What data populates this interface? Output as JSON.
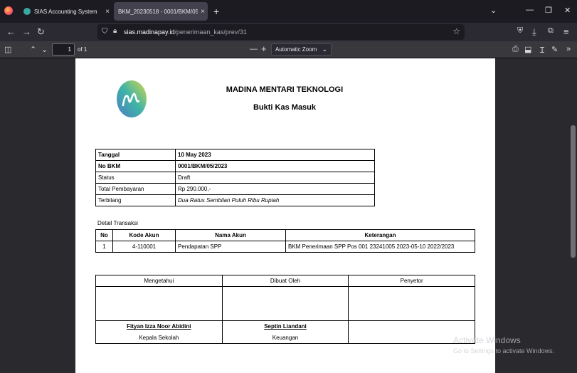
{
  "tabs": [
    {
      "label": "SIAS Accounting System",
      "close": "×"
    },
    {
      "label": "BKM_20230518 - 0001/BKM/05/2023",
      "close": "×"
    }
  ],
  "new_tab": "+",
  "window_controls": {
    "list": "⌄",
    "minimize": "—",
    "restore": "❐",
    "close": "✕"
  },
  "nav": {
    "back": "←",
    "forward": "→",
    "reload": "↻"
  },
  "address": {
    "host": "sias.madinapay.id",
    "path": "/penerimaan_kas/prev/31"
  },
  "pdf_toolbar": {
    "page": "1",
    "of": "of 1",
    "zoom": "Automatic Zoom",
    "zoom_out": "—",
    "zoom_in": "+"
  },
  "document": {
    "company": "MADINA MENTARI TEKNOLOGI",
    "title": "Bukti Kas Masuk",
    "info": [
      {
        "label": "Tanggal",
        "value": "10 May 2023",
        "bold": true
      },
      {
        "label": "No BKM",
        "value": "0001/BKM/05/2023",
        "bold": true
      },
      {
        "label": "Status",
        "value": "Draft",
        "bold": false
      },
      {
        "label": "Total Pembayaran",
        "value": "Rp 290.000,-",
        "bold": false
      },
      {
        "label": "Terbilang",
        "value": "Dua Ratus Sembilan Puluh  Ribu Rupiah",
        "bold": false
      }
    ],
    "detail_label": "Detail Transaksi",
    "detail_headers": [
      "No",
      "Kode Akun",
      "Nama Akun",
      "Keterangan"
    ],
    "detail_rows": [
      [
        "1",
        "4-110001",
        "Pendapatan SPP",
        "BKM Penerimaan SPP Pos 001 23241005 2023-05-10 2022/2023"
      ]
    ],
    "signatures": {
      "headers": [
        "Mengetahui",
        "Dibuat Oleh",
        "Penyetor"
      ],
      "names": [
        "Fityan Izza Noor Abidini",
        "Septin Liandani",
        ""
      ],
      "roles": [
        "Kepala Sekolah",
        "Keuangan",
        ""
      ]
    }
  },
  "watermark": {
    "line1": "Activate Windows",
    "line2": "Go to Settings to activate Windows."
  },
  "colors": {
    "logo_teal": "#3fb3a8",
    "logo_yellow": "#d6d94a",
    "logo_blue": "#4a7fc0"
  }
}
